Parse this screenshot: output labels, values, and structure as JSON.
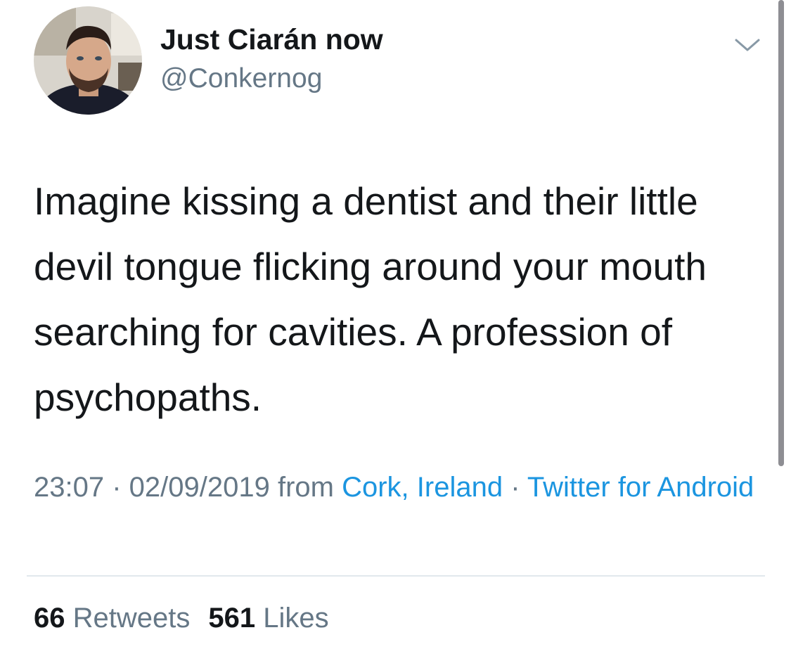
{
  "author": {
    "display_name": "Just Ciarán now",
    "handle": "@Conkernog"
  },
  "tweet": {
    "text": "Imagine kissing a dentist and their little devil tongue flicking around your mouth searching for cavities. A profession of psychopaths."
  },
  "meta": {
    "time": "23:07",
    "separator": " · ",
    "date": "02/09/2019",
    "from_label": " from ",
    "location": "Cork, Ireland",
    "source": "Twitter for Android"
  },
  "stats": {
    "retweets_count": "66",
    "retweets_label": "Retweets",
    "likes_count": "561",
    "likes_label": "Likes"
  },
  "icons": {
    "caret": "chevron-down-icon"
  },
  "colors": {
    "link": "#1b95e0",
    "secondary_text": "#657786",
    "primary_text": "#14171a",
    "divider": "#e1e8ed"
  }
}
